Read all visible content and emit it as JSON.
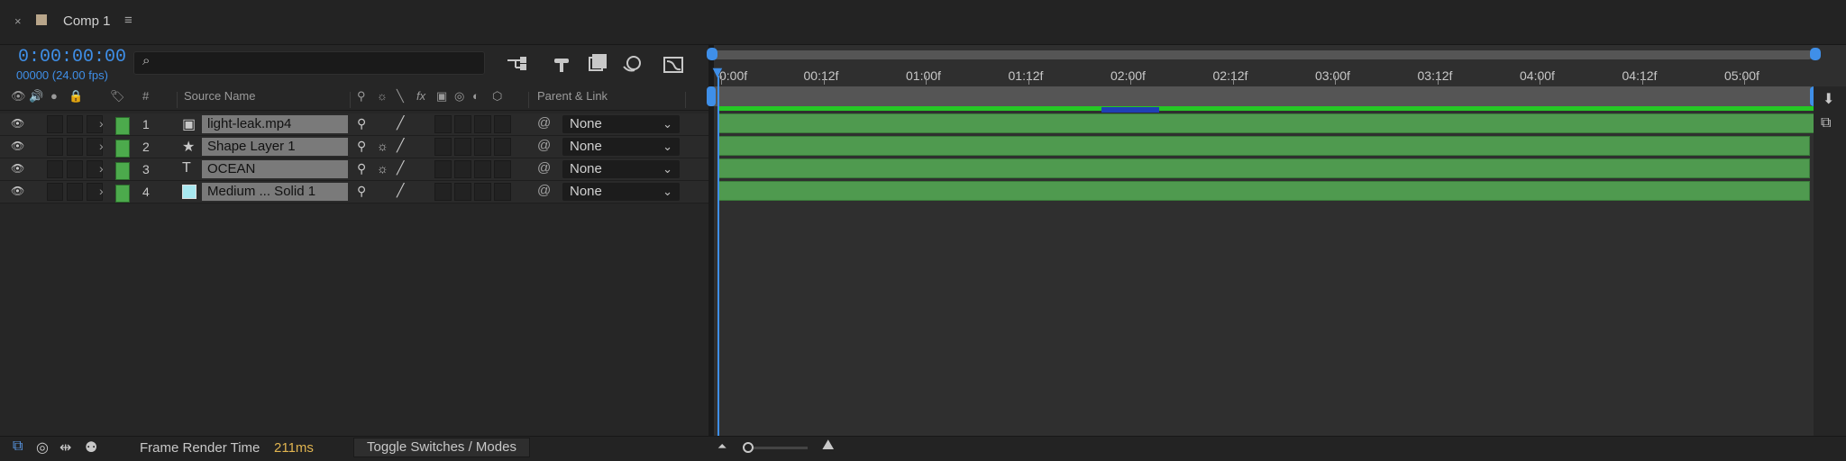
{
  "tab": {
    "close": "×",
    "title": "Comp 1",
    "menu": "≡"
  },
  "timecode": {
    "value": "0:00:00:00",
    "fps": "00000 (24.00 fps)"
  },
  "search": {
    "placeholder": ""
  },
  "headers": {
    "number": "#",
    "source_name": "Source Name",
    "parent_link": "Parent & Link"
  },
  "layers": [
    {
      "num": "1",
      "type": "footage",
      "type_glyph": "▣",
      "name": "light-leak.mp4",
      "parent": "None",
      "has_quality_switch": false
    },
    {
      "num": "2",
      "type": "shape",
      "type_glyph": "★",
      "name": "Shape Layer 1",
      "parent": "None",
      "has_quality_switch": true
    },
    {
      "num": "3",
      "type": "text",
      "type_glyph": "T",
      "name": "OCEAN",
      "parent": "None",
      "has_quality_switch": true
    },
    {
      "num": "4",
      "type": "solid",
      "type_glyph": "",
      "name": "Medium ... Solid 1",
      "parent": "None",
      "has_quality_switch": false
    }
  ],
  "label_color": "#4caa4c",
  "solid_color": "#a8e8f0",
  "accent_color": "#3f8fe8",
  "ruler": [
    "0:00f",
    "00:12f",
    "01:00f",
    "01:12f",
    "02:00f",
    "02:12f",
    "03:00f",
    "03:12f",
    "04:00f",
    "04:12f",
    "05:00f"
  ],
  "footer": {
    "frame_render_label": "Frame Render Time",
    "frame_render_value": "211ms",
    "toggle_label": "Toggle Switches / Modes"
  }
}
